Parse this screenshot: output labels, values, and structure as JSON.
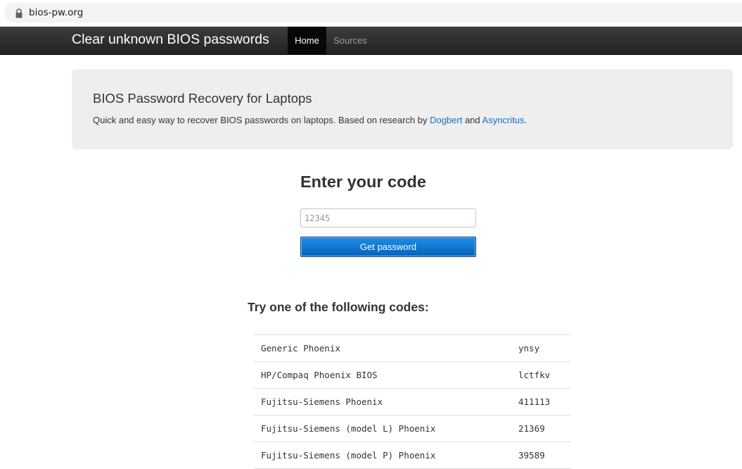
{
  "browser": {
    "url": "bios-pw.org"
  },
  "navbar": {
    "brand": "Clear unknown BIOS passwords",
    "items": [
      {
        "label": "Home",
        "active": true
      },
      {
        "label": "Sources",
        "active": false
      }
    ]
  },
  "jumbotron": {
    "title": "BIOS Password Recovery for Laptops",
    "text_before": "Quick and easy way to recover BIOS passwords on laptops. Based on research by ",
    "link1": "Dogbert",
    "text_middle": " and ",
    "link2": "Asyncritus",
    "text_after": "."
  },
  "form": {
    "heading": "Enter your code",
    "input_placeholder": "12345",
    "input_value": "",
    "button_label": "Get password"
  },
  "codes": {
    "heading": "Try one of the following codes:",
    "rows": [
      {
        "name": "Generic Phoenix",
        "code": "ynsy"
      },
      {
        "name": "HP/Compaq Phoenix BIOS",
        "code": "lctfkv"
      },
      {
        "name": "Fujitsu-Siemens Phoenix",
        "code": "411113"
      },
      {
        "name": "Fujitsu-Siemens (model L) Phoenix",
        "code": "21369"
      },
      {
        "name": "Fujitsu-Siemens (model P) Phoenix",
        "code": "39589"
      }
    ]
  },
  "colors": {
    "navbar": "#222222",
    "link": "#1a6fc2",
    "button": "#0562b8",
    "jumbotron": "#eeeeee"
  }
}
